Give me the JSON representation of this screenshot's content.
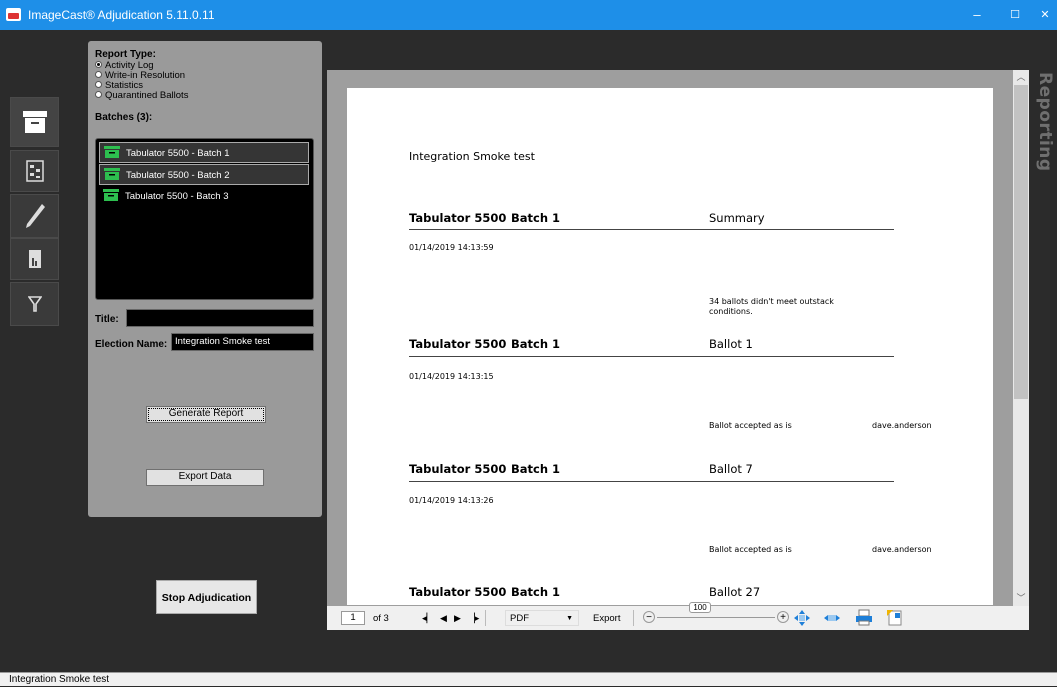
{
  "window": {
    "title": "ImageCast® Adjudication 5.11.0.11",
    "minimize": "–",
    "maximize": "☐",
    "close": "✕"
  },
  "nav": {
    "items": [
      {
        "name": "batches",
        "icon": "archive-box-icon"
      },
      {
        "name": "hierarchy",
        "icon": "tree-list-icon"
      },
      {
        "name": "adjudicate",
        "icon": "pencil-icon"
      },
      {
        "name": "reporting",
        "icon": "report-document-icon"
      },
      {
        "name": "filter",
        "icon": "filter-funnel-icon"
      }
    ]
  },
  "report_panel": {
    "report_type_label": "Report Type:",
    "report_types": [
      {
        "label": "Activity Log",
        "selected": true
      },
      {
        "label": "Write-in Resolution",
        "selected": false
      },
      {
        "label": "Statistics",
        "selected": false
      },
      {
        "label": "Quarantined Ballots",
        "selected": false
      }
    ],
    "batches_label": "Batches (3):",
    "batches": [
      {
        "label": "Tabulator 5500 - Batch 1",
        "selected": true
      },
      {
        "label": "Tabulator 5500 - Batch 2",
        "selected": true
      },
      {
        "label": "Tabulator 5500 - Batch 3",
        "selected": false
      }
    ],
    "title_label": "Title:",
    "title_value": "",
    "election_label": "Election Name:",
    "election_value": "Integration Smoke test",
    "generate_button": "Generate Report",
    "export_button": "Export Data"
  },
  "stop_button": "Stop Adjudication",
  "report": {
    "title": "Integration Smoke test",
    "sections": [
      {
        "tabulator": "Tabulator 5500",
        "batch": "Batch 1",
        "right": "Summary",
        "timestamp": "01/14/2019 14:13:59",
        "note": "34 ballots didn't meet outstack conditions.",
        "user": ""
      },
      {
        "tabulator": "Tabulator 5500",
        "batch": "Batch 1",
        "right": "Ballot 1",
        "timestamp": "01/14/2019 14:13:15",
        "note": "Ballot accepted as is",
        "user": "dave.anderson"
      },
      {
        "tabulator": "Tabulator 5500",
        "batch": "Batch 1",
        "right": "Ballot 7",
        "timestamp": "01/14/2019 14:13:26",
        "note": "Ballot accepted as is",
        "user": "dave.anderson"
      },
      {
        "tabulator": "Tabulator 5500",
        "batch": "Batch 1",
        "right": "Ballot 27",
        "timestamp": "",
        "note": "",
        "user": ""
      }
    ]
  },
  "viewer_toolbar": {
    "page_current": "1",
    "page_of": "of 3",
    "format": "PDF",
    "export": "Export",
    "zoom": "100"
  },
  "side_tab": "Reporting",
  "status_text": "Integration Smoke test",
  "colors": {
    "titlebar": "#1e8fe8",
    "app_bg": "#2b2b2b",
    "panel_bg": "#9a9a9a",
    "batch_icon": "#2dbf4f"
  }
}
